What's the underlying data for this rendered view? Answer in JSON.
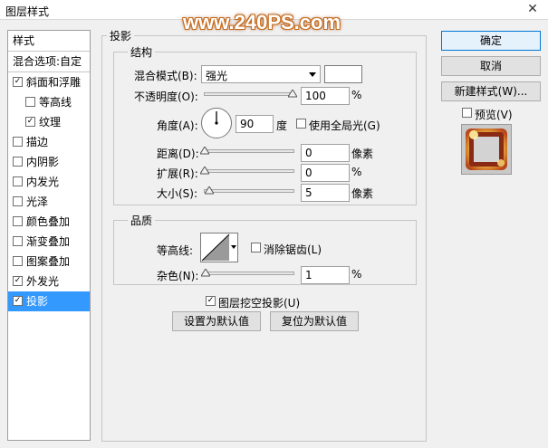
{
  "window": {
    "title": "图层样式",
    "close": "✕"
  },
  "watermark": "www.240PS.com",
  "left_panel": {
    "header": "样式",
    "blend_options": "混合选项:自定",
    "items": [
      {
        "label": "斜面和浮雕",
        "checked": true
      },
      {
        "label": "等高线",
        "checked": false
      },
      {
        "label": "纹理",
        "checked": true
      },
      {
        "label": "描边",
        "checked": false
      },
      {
        "label": "内阴影",
        "checked": false
      },
      {
        "label": "内发光",
        "checked": false
      },
      {
        "label": "光泽",
        "checked": false
      },
      {
        "label": "颜色叠加",
        "checked": false
      },
      {
        "label": "渐变叠加",
        "checked": false
      },
      {
        "label": "图案叠加",
        "checked": false
      },
      {
        "label": "外发光",
        "checked": true
      },
      {
        "label": "投影",
        "checked": true
      }
    ]
  },
  "drop_shadow": {
    "section_title": "投影",
    "structure": {
      "title": "结构",
      "blend_mode_label": "混合模式(B):",
      "blend_mode_value": "强光",
      "blend_color": "#ffffff",
      "opacity_label": "不透明度(O):",
      "opacity_value": "100",
      "opacity_unit": "%",
      "angle_label": "角度(A):",
      "angle_value": "90",
      "angle_unit": "度",
      "global_light_label": "使用全局光(G)",
      "global_light_checked": false,
      "distance_label": "距离(D):",
      "distance_value": "0",
      "distance_unit": "像素",
      "spread_label": "扩展(R):",
      "spread_value": "0",
      "spread_unit": "%",
      "size_label": "大小(S):",
      "size_value": "5",
      "size_unit": "像素"
    },
    "quality": {
      "title": "品质",
      "contour_label": "等高线:",
      "antialias_label": "消除锯齿(L)",
      "antialias_checked": false,
      "noise_label": "杂色(N):",
      "noise_value": "1",
      "noise_unit": "%"
    },
    "knockout_label": "图层挖空投影(U)",
    "knockout_checked": true,
    "make_default": "设置为默认值",
    "reset_default": "复位为默认值"
  },
  "buttons": {
    "ok": "确定",
    "cancel": "取消",
    "new_style": "新建样式(W)...",
    "preview": "预览(V)"
  },
  "colors": {
    "selection": "#3399ff",
    "primary_border": "#0078d7"
  }
}
